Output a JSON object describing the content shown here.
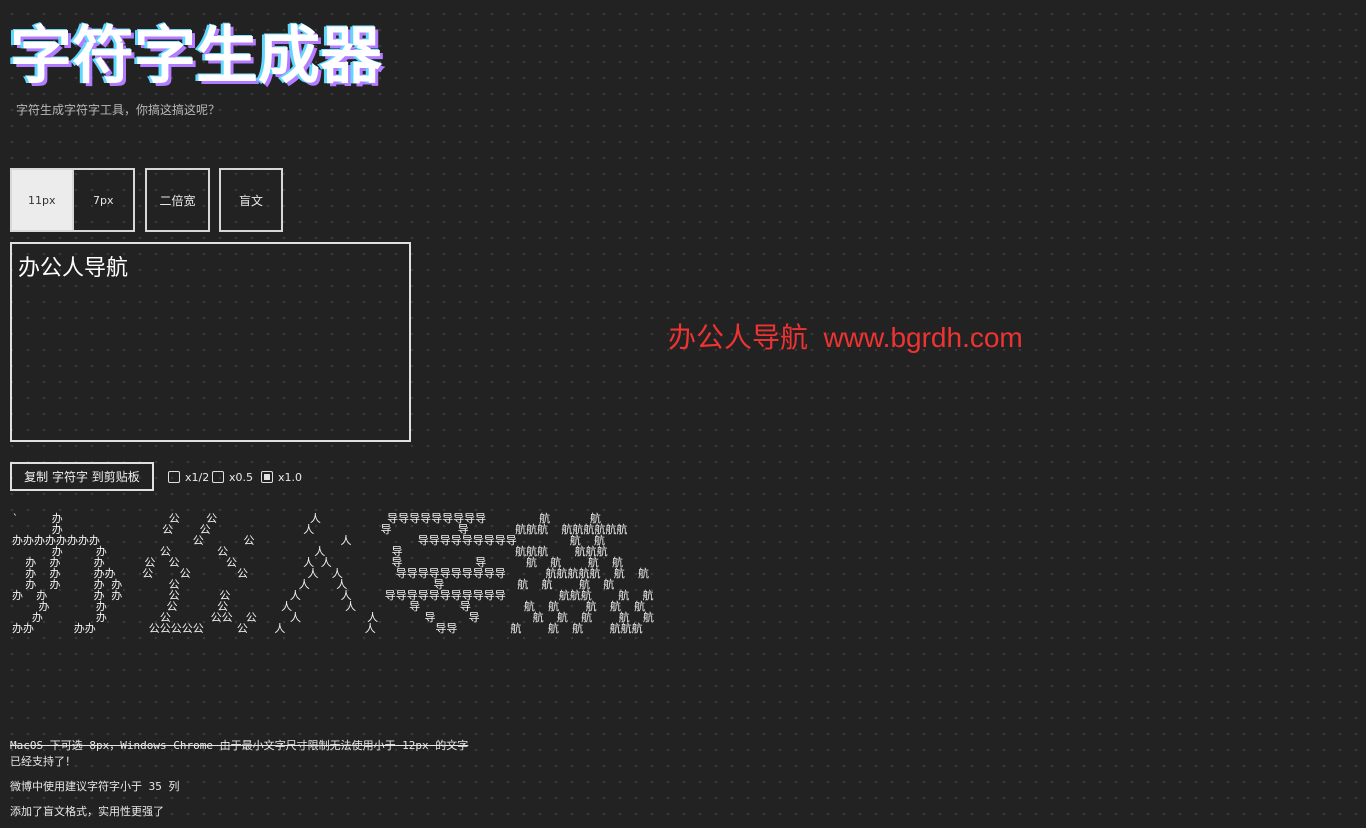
{
  "header": {
    "title": "字符字生成器",
    "subtitle": "字符生成字符字工具，你搞这搞这呢？"
  },
  "font_size": {
    "options": [
      "11px",
      "7px"
    ],
    "selected": "11px"
  },
  "mode_buttons": {
    "double_width": "二倍宽",
    "braille": "盲文"
  },
  "input": {
    "value": "办公人导航"
  },
  "watermark": "办公人导航  www.bgrdh.com",
  "copy_button": "复制 字符字 到剪贴板",
  "scale_options": [
    {
      "label": "x1/2",
      "checked": false
    },
    {
      "label": "x0.5",
      "checked": false
    },
    {
      "label": "x1.0",
      "checked": true
    }
  ],
  "ascii_art": "`     办                公    公              人          导导导导导导导导导        航      航\n      办               公    公              人          导          导       航航航  航航航航航航\n办办办办办办办办              公      公             人          导导导导导导导导导        航  航\n      办     办        公       公             人          导                 航航航    航航航\n  办  办     办      公  公       公          人 人         导           导      航  航    航  航\n  办  办     办办    公    公       公         人  人        导导导导导导导导导导      航航航航航  航  航\n  办  办     办 办       公                  人    人             导           航  航    航  航\n办  办       办 办       公      公         人      人     导导导导导导导导导导导        航航航    航  航\n    办       办         公      公        人        人        导      导        航  航    航  航  航\n   办        办        公      公公  公     人          人       导     导        航  航  航    航  航\n办办      办办        公公公公公     公    人            人         导导        航    航  航    航航航",
  "notes": {
    "strike": "MacOS 下可选 8px，Windows Chrome 由于最小文字尺寸限制无法使用小于 12px 的文字",
    "supported": "已经支持了！",
    "weibo": "微博中使用建议字符字小于 35 列",
    "braille": "添加了盲文格式，实用性更强了"
  }
}
